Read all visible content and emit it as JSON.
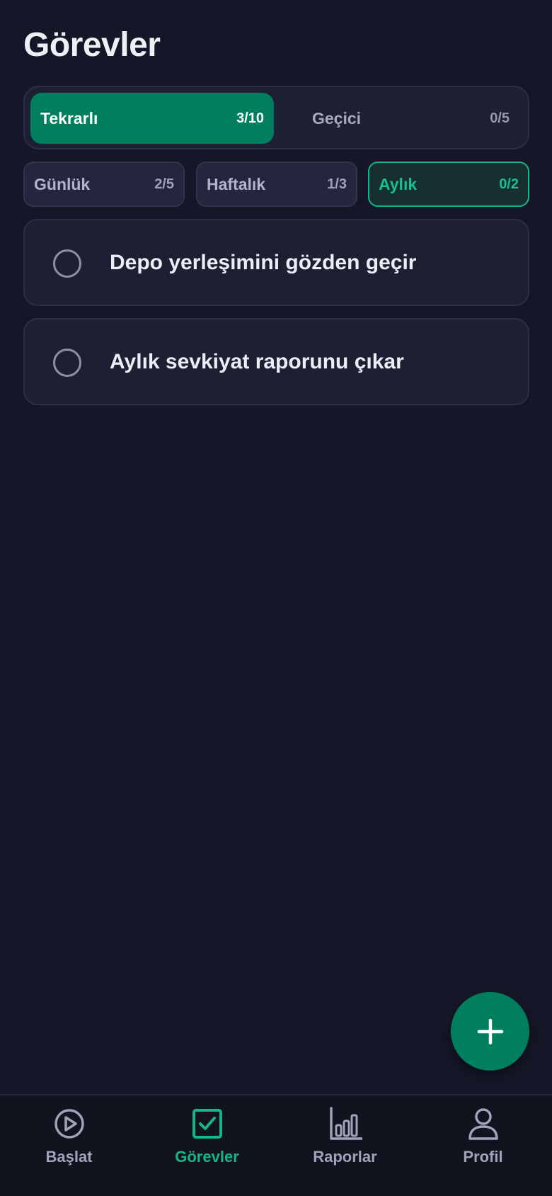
{
  "page": {
    "title": "Görevler"
  },
  "segment": {
    "active": {
      "label": "Tekrarlı",
      "count": "3/10"
    },
    "inactive": {
      "label": "Geçici",
      "count": "0/5"
    }
  },
  "periods": [
    {
      "label": "Günlük",
      "count": "2/5",
      "selected": false
    },
    {
      "label": "Haftalık",
      "count": "1/3",
      "selected": false
    },
    {
      "label": "Aylık",
      "count": "0/2",
      "selected": true
    }
  ],
  "tasks": [
    {
      "text": "Depo yerleşimini gözden geçir",
      "done": false
    },
    {
      "text": "Aylık sevkiyat raporunu çıkar",
      "done": false
    }
  ],
  "fab": {
    "icon": "plus-icon"
  },
  "nav": [
    {
      "label": "Başlat",
      "icon": "play-circle-icon",
      "active": false
    },
    {
      "label": "Görevler",
      "icon": "checkbox-icon",
      "active": true
    },
    {
      "label": "Raporlar",
      "icon": "bar-chart-icon",
      "active": false
    },
    {
      "label": "Profil",
      "icon": "user-icon",
      "active": false
    }
  ],
  "colors": {
    "background": "#151728",
    "accent": "#007f5f",
    "accent_text": "#14b586",
    "card": "#1d1f33"
  }
}
